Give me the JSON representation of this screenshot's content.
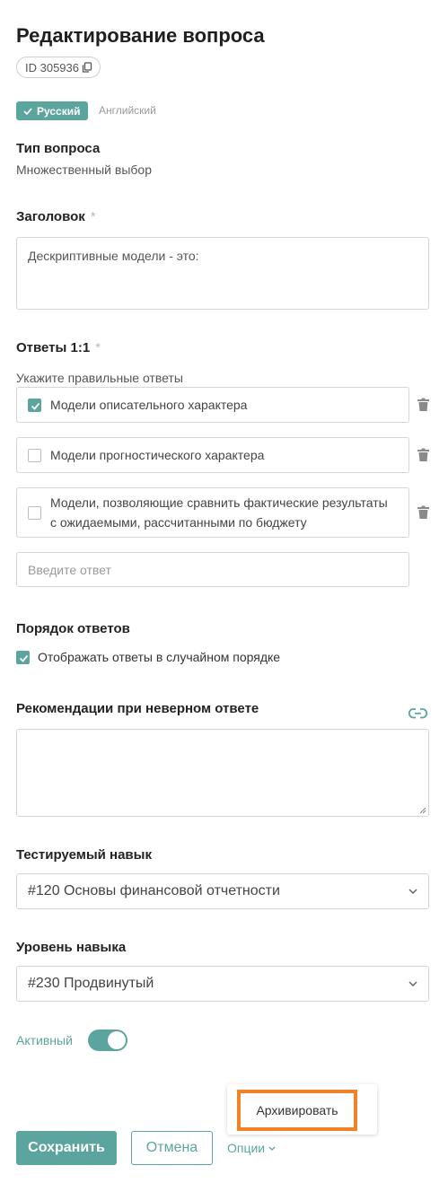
{
  "header": {
    "title": "Редактирование вопроса",
    "id_label": "ID 305936"
  },
  "languages": {
    "active": "Русский",
    "inactive": "Английский"
  },
  "question_type": {
    "label": "Тип вопроса",
    "value": "Множественный выбор"
  },
  "heading": {
    "label": "Заголовок",
    "required_mark": "*",
    "value": "Дескриптивные модели - это:"
  },
  "answers": {
    "label": "Ответы 1:1",
    "required_mark": "*",
    "hint": "Укажите правильные ответы",
    "items": [
      {
        "text": "Модели описательного характера",
        "checked": true
      },
      {
        "text": "Модели прогностического характера",
        "checked": false
      },
      {
        "line1": "Модели, позволяющие сравнить фактические результаты",
        "line2": "с ожидаемыми, рассчитанными по бюджету",
        "checked": false
      }
    ],
    "new_placeholder": "Введите ответ"
  },
  "order": {
    "label": "Порядок ответов",
    "checkbox_label": "Отображать ответы в случайном порядке",
    "checked": true
  },
  "recommendations": {
    "label": "Рекомендации при неверном ответе",
    "value": ""
  },
  "skill": {
    "label": "Тестируемый навык",
    "value": "#120 Основы финансовой отчетности"
  },
  "level": {
    "label": "Уровень навыка",
    "value": "#230 Продвинутый"
  },
  "active": {
    "label": "Активный",
    "on": true
  },
  "footer": {
    "save": "Сохранить",
    "cancel": "Отмена",
    "options": "Опции"
  },
  "options_menu": {
    "items": [
      "Архивировать"
    ]
  },
  "colors": {
    "accent": "#5ba59e",
    "highlight": "#f28228"
  }
}
